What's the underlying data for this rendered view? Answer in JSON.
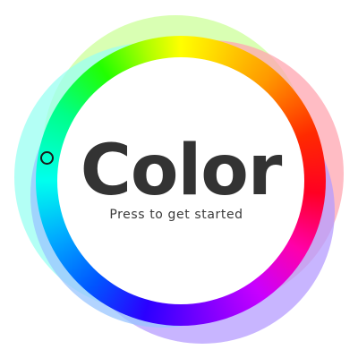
{
  "app": {
    "title": "Color",
    "prompt": "Press to get started"
  },
  "wheel": {
    "selector_hue": "cyan",
    "halo_colors": [
      "#ccff99",
      "#ffa6b0",
      "#b59cff",
      "#99fff2",
      "#99c6ff"
    ],
    "text_color": "#333333"
  }
}
